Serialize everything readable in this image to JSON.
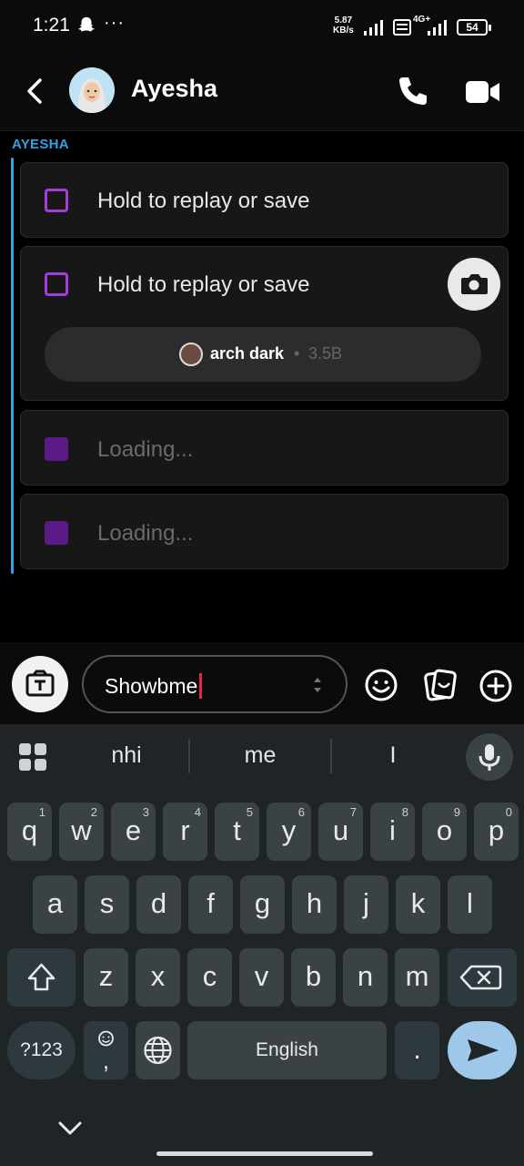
{
  "status_bar": {
    "time": "1:21",
    "more": "···",
    "net_speed_value": "5.87",
    "net_speed_unit": "KB/s",
    "network": "4G+",
    "battery": "54"
  },
  "header": {
    "contact_name": "Ayesha"
  },
  "chat": {
    "sender_label": "AYESHA",
    "snaps": [
      {
        "text": "Hold to replay or save",
        "state": "opened"
      },
      {
        "text": "Hold to replay or save",
        "state": "opened"
      },
      {
        "text": "Loading...",
        "state": "loading"
      },
      {
        "text": "Loading...",
        "state": "loading"
      }
    ],
    "reaction": {
      "name": "arch dark",
      "separator": "•",
      "size": "3.5B"
    }
  },
  "composer": {
    "text": "Showbme"
  },
  "keyboard": {
    "suggestions": [
      "nhi",
      "me",
      "I"
    ],
    "rows": [
      [
        {
          "k": "q",
          "h": "1"
        },
        {
          "k": "w",
          "h": "2"
        },
        {
          "k": "e",
          "h": "3"
        },
        {
          "k": "r",
          "h": "4"
        },
        {
          "k": "t",
          "h": "5"
        },
        {
          "k": "y",
          "h": "6"
        },
        {
          "k": "u",
          "h": "7"
        },
        {
          "k": "i",
          "h": "8"
        },
        {
          "k": "o",
          "h": "9"
        },
        {
          "k": "p",
          "h": "0"
        }
      ],
      [
        {
          "k": "a"
        },
        {
          "k": "s"
        },
        {
          "k": "d"
        },
        {
          "k": "f"
        },
        {
          "k": "g"
        },
        {
          "k": "h"
        },
        {
          "k": "j"
        },
        {
          "k": "k"
        },
        {
          "k": "l"
        }
      ],
      [
        {
          "k": "z"
        },
        {
          "k": "x"
        },
        {
          "k": "c"
        },
        {
          "k": "v"
        },
        {
          "k": "b"
        },
        {
          "k": "n"
        },
        {
          "k": "m"
        }
      ]
    ],
    "symbols_label": "?123",
    "comma_label": ",",
    "space_label": "English",
    "period_label": "."
  },
  "colors": {
    "accent_blue": "#2fa3e6",
    "snap_purple": "#a63bd8",
    "caret_red": "#e2264d",
    "enter_blue": "#9fc7ea"
  }
}
